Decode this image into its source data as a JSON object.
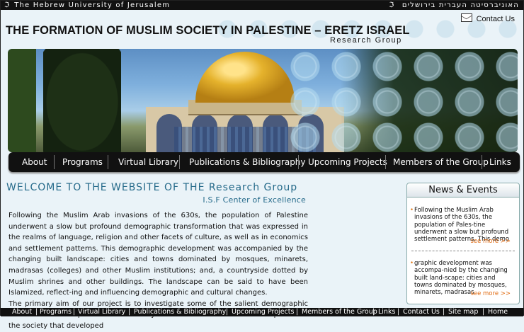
{
  "top_bar": {
    "english": "The Hebrew University of Jerusalem",
    "hebrew": "האוניברסיטה העברית בירושלים"
  },
  "header": {
    "contact_label": "Contact Us",
    "title": "THE FORMATION OF MUSLIM SOCIETY IN PALESTINE – ERETZ ISRAEL",
    "subtitle": "Research Group"
  },
  "nav": {
    "items": [
      "About",
      "Programs",
      "Virtual Library",
      "Publications & Bibliography",
      "Upcoming Projects",
      "Members of the Group",
      "Links"
    ]
  },
  "main": {
    "welcome": "WELCOME TO THE WEBSITE OF THE Research Group",
    "center": "I.S.F Center of Excellence",
    "paragraph1": "Following the Muslim Arab invasions of the 630s, the population of Palestine underwent a slow but profound demographic transformation that was expressed in the realms of language, religion and other facets of culture, as well as in economics and settlement patterns. This demographic development was accompanied by the changing built landscape: cities and towns dominated by mosques, minarets, madrasas (colleges) and other Muslim institutions; and, a countryside dotted by Muslim shrines and other buildings. The landscape can be said to have been Islamized, reflect-ing and influencing demographic and cultural changes.",
    "paragraph2": "The primary aim of our project is to investigate some of the salient demographic and cultural developments in the history of Palestine and create a richer picture of the society that developed"
  },
  "news": {
    "title": "News & Events",
    "items": [
      {
        "text": "Following the Muslim Arab invasions of the 630s, the population of Pales-tine underwent a slow but profound settlement patterns. This demo",
        "more": "see more >>"
      },
      {
        "text": "graphic development was accompa-nied by the changing built land-scape: cities and towns dominated by mosques, minarets, madrasas",
        "more": "see more >>"
      }
    ]
  },
  "footer": {
    "items": [
      "About",
      "Programs",
      "Virtual Library",
      "Publications & Bibliography",
      "Upcoming Projects",
      "Members of the Group",
      "Links",
      "Contact Us",
      "Site map",
      "Home"
    ]
  },
  "colors": {
    "accent": "#256a8a",
    "bar": "#111111",
    "more_link": "#e06a10"
  }
}
